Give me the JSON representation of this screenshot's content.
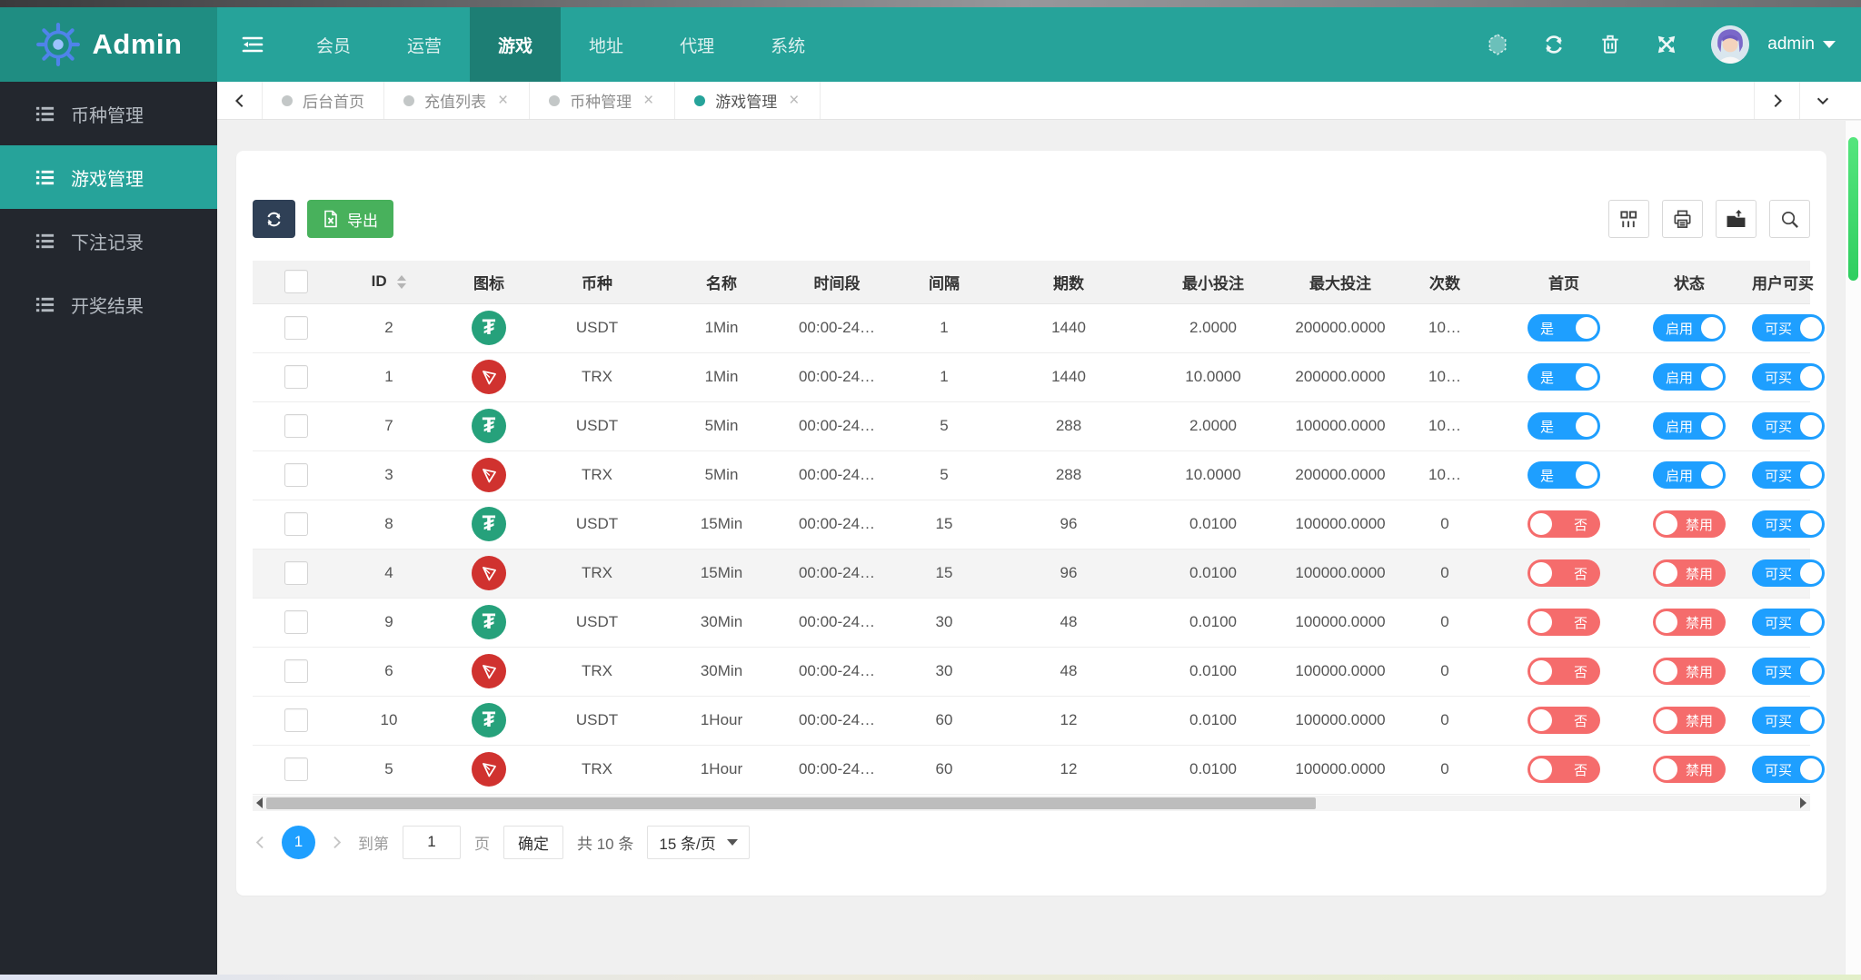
{
  "colors": {
    "header_teal": "#26a39a",
    "header_dark_teal": "#1f8d82",
    "nav_active_teal": "#1d7e74",
    "sidebar_bg": "#23272e",
    "toggle_on_blue": "#1e9fff",
    "toggle_off_red": "#f56c6c",
    "export_green": "#48b15c",
    "refresh_navy": "#2f4056",
    "usdt_green": "#26a17b",
    "trx_red": "#d0322f",
    "scroll_green": "#3fd96b"
  },
  "navbar": {
    "brand": "Admin",
    "username": "admin",
    "menu": [
      {
        "label": "会员"
      },
      {
        "label": "运营"
      },
      {
        "label": "游戏",
        "active": true
      },
      {
        "label": "地址"
      },
      {
        "label": "代理"
      },
      {
        "label": "系统"
      }
    ],
    "icons": [
      "hexagon-icon",
      "refresh-icon",
      "trash-icon",
      "fullscreen-icon"
    ]
  },
  "sidebar": {
    "items": [
      {
        "label": "币种管理"
      },
      {
        "label": "游戏管理",
        "active": true
      },
      {
        "label": "下注记录"
      },
      {
        "label": "开奖结果"
      }
    ]
  },
  "tabs": {
    "items": [
      {
        "label": "后台首页",
        "closable": false
      },
      {
        "label": "充值列表",
        "closable": true
      },
      {
        "label": "币种管理",
        "closable": true
      },
      {
        "label": "游戏管理",
        "closable": true,
        "active": true
      }
    ]
  },
  "toolbar": {
    "export_label": "导出"
  },
  "table": {
    "columns": [
      {
        "label": "",
        "type": "check"
      },
      {
        "label": "ID",
        "sortable": true
      },
      {
        "label": "图标"
      },
      {
        "label": "币种"
      },
      {
        "label": "名称"
      },
      {
        "label": "时间段"
      },
      {
        "label": "间隔"
      },
      {
        "label": "期数"
      },
      {
        "label": "最小投注"
      },
      {
        "label": "最大投注"
      },
      {
        "label": "次数"
      },
      {
        "label": "首页"
      },
      {
        "label": "状态"
      },
      {
        "label": "用户可买"
      }
    ],
    "rows": [
      {
        "id": "2",
        "icon": "usdt",
        "coin": "USDT",
        "name": "1Min",
        "period": "00:00-24…",
        "interval": "1",
        "issues": "1440",
        "min_bet": "2.0000",
        "max_bet": "200000.0000",
        "times": "10…",
        "home": {
          "label": "是",
          "on": true
        },
        "status": {
          "label": "启用",
          "on": true
        },
        "buyable": {
          "label": "可买",
          "on": true
        }
      },
      {
        "id": "1",
        "icon": "trx",
        "coin": "TRX",
        "name": "1Min",
        "period": "00:00-24…",
        "interval": "1",
        "issues": "1440",
        "min_bet": "10.0000",
        "max_bet": "200000.0000",
        "times": "10…",
        "home": {
          "label": "是",
          "on": true
        },
        "status": {
          "label": "启用",
          "on": true
        },
        "buyable": {
          "label": "可买",
          "on": true
        }
      },
      {
        "id": "7",
        "icon": "usdt",
        "coin": "USDT",
        "name": "5Min",
        "period": "00:00-24…",
        "interval": "5",
        "issues": "288",
        "min_bet": "2.0000",
        "max_bet": "100000.0000",
        "times": "10…",
        "home": {
          "label": "是",
          "on": true
        },
        "status": {
          "label": "启用",
          "on": true
        },
        "buyable": {
          "label": "可买",
          "on": true
        }
      },
      {
        "id": "3",
        "icon": "trx",
        "coin": "TRX",
        "name": "5Min",
        "period": "00:00-24…",
        "interval": "5",
        "issues": "288",
        "min_bet": "10.0000",
        "max_bet": "200000.0000",
        "times": "10…",
        "home": {
          "label": "是",
          "on": true
        },
        "status": {
          "label": "启用",
          "on": true
        },
        "buyable": {
          "label": "可买",
          "on": true
        }
      },
      {
        "id": "8",
        "icon": "usdt",
        "coin": "USDT",
        "name": "15Min",
        "period": "00:00-24…",
        "interval": "15",
        "issues": "96",
        "min_bet": "0.0100",
        "max_bet": "100000.0000",
        "times": "0",
        "home": {
          "label": "否",
          "on": false
        },
        "status": {
          "label": "禁用",
          "on": false
        },
        "buyable": {
          "label": "可买",
          "on": true
        }
      },
      {
        "id": "4",
        "icon": "trx",
        "coin": "TRX",
        "name": "15Min",
        "period": "00:00-24…",
        "interval": "15",
        "issues": "96",
        "min_bet": "0.0100",
        "max_bet": "100000.0000",
        "times": "0",
        "home": {
          "label": "否",
          "on": false
        },
        "status": {
          "label": "禁用",
          "on": false
        },
        "buyable": {
          "label": "可买",
          "on": true
        },
        "highlighted": true
      },
      {
        "id": "9",
        "icon": "usdt",
        "coin": "USDT",
        "name": "30Min",
        "period": "00:00-24…",
        "interval": "30",
        "issues": "48",
        "min_bet": "0.0100",
        "max_bet": "100000.0000",
        "times": "0",
        "home": {
          "label": "否",
          "on": false
        },
        "status": {
          "label": "禁用",
          "on": false
        },
        "buyable": {
          "label": "可买",
          "on": true
        }
      },
      {
        "id": "6",
        "icon": "trx",
        "coin": "TRX",
        "name": "30Min",
        "period": "00:00-24…",
        "interval": "30",
        "issues": "48",
        "min_bet": "0.0100",
        "max_bet": "100000.0000",
        "times": "0",
        "home": {
          "label": "否",
          "on": false
        },
        "status": {
          "label": "禁用",
          "on": false
        },
        "buyable": {
          "label": "可买",
          "on": true
        }
      },
      {
        "id": "10",
        "icon": "usdt",
        "coin": "USDT",
        "name": "1Hour",
        "period": "00:00-24…",
        "interval": "60",
        "issues": "12",
        "min_bet": "0.0100",
        "max_bet": "100000.0000",
        "times": "0",
        "home": {
          "label": "否",
          "on": false
        },
        "status": {
          "label": "禁用",
          "on": false
        },
        "buyable": {
          "label": "可买",
          "on": true
        }
      },
      {
        "id": "5",
        "icon": "trx",
        "coin": "TRX",
        "name": "1Hour",
        "period": "00:00-24…",
        "interval": "60",
        "issues": "12",
        "min_bet": "0.0100",
        "max_bet": "100000.0000",
        "times": "0",
        "home": {
          "label": "否",
          "on": false
        },
        "status": {
          "label": "禁用",
          "on": false
        },
        "buyable": {
          "label": "可买",
          "on": true
        }
      }
    ]
  },
  "pagination": {
    "current_page": "1",
    "goto_label": "到第",
    "goto_value": "1",
    "page_unit": "页",
    "confirm_label": "确定",
    "total_label": "共 10 条",
    "page_size": "15 条/页"
  }
}
